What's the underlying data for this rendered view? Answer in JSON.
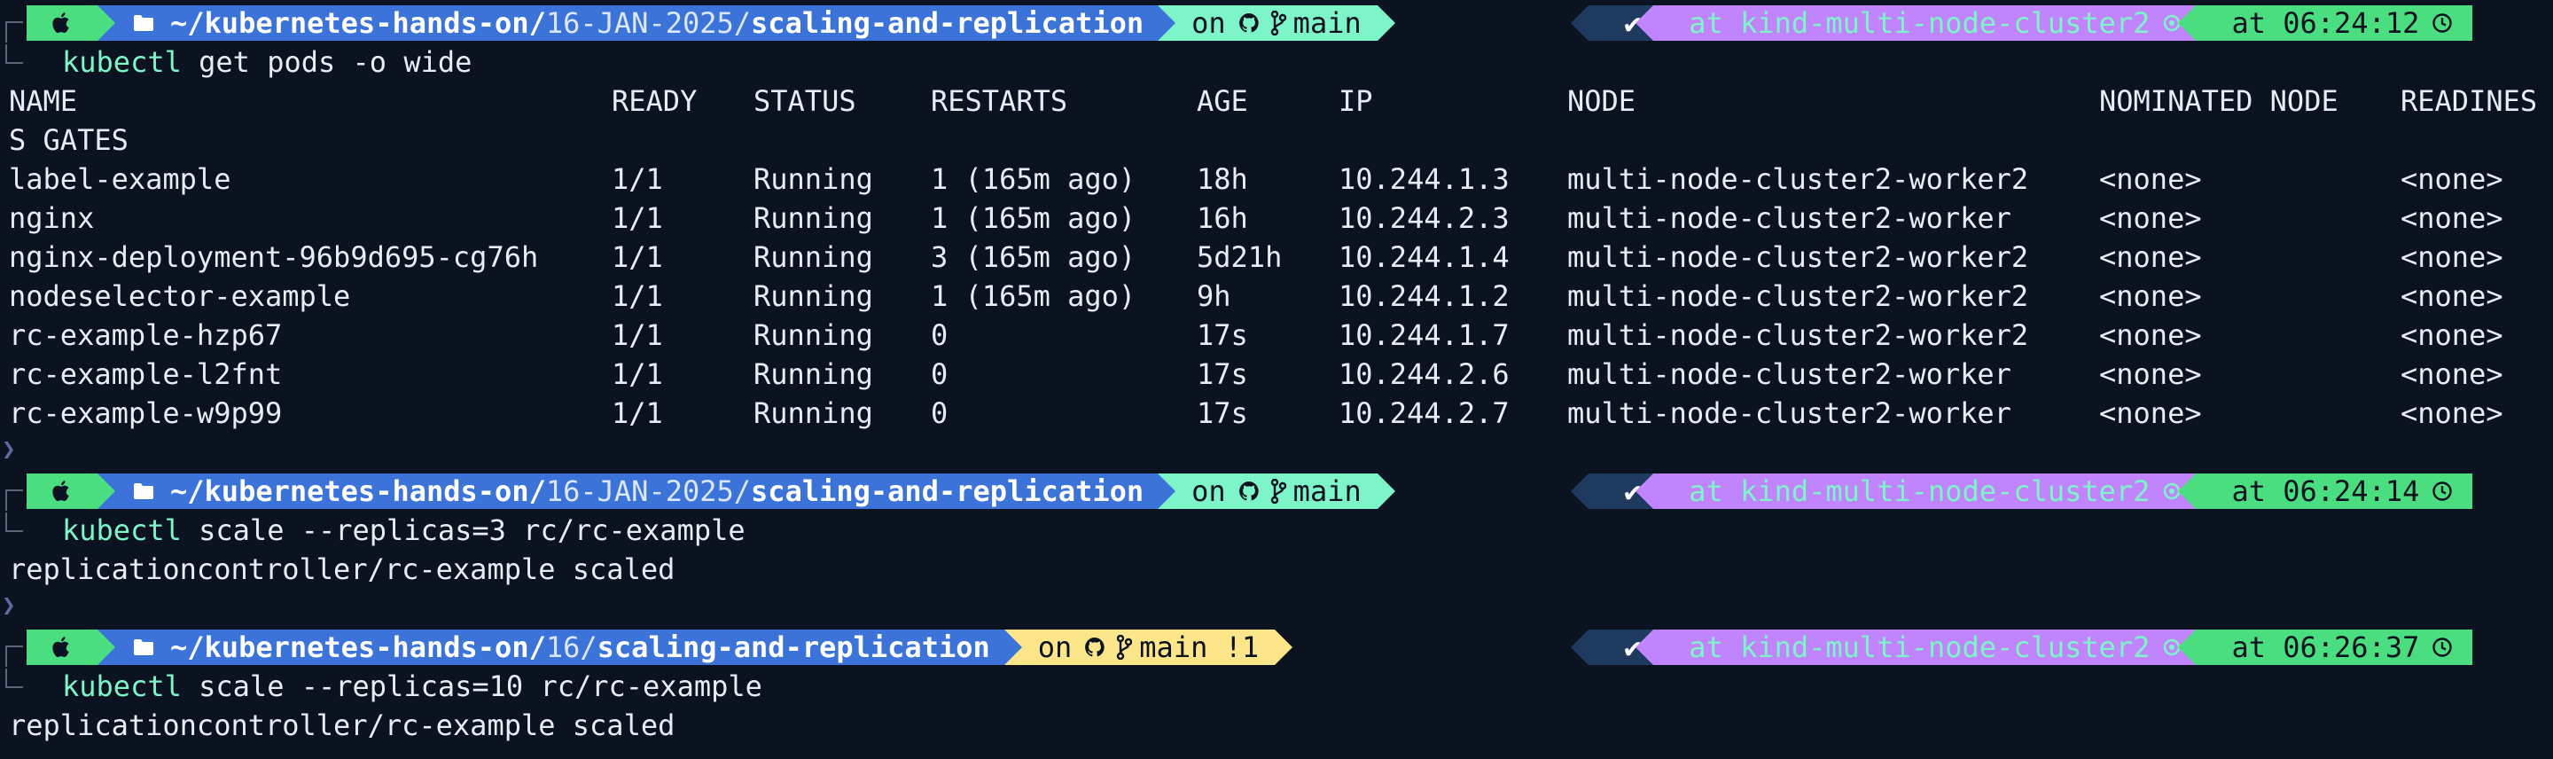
{
  "prompts": [
    {
      "path_prefix": "~/kubernetes-hands-on/",
      "path_mid": "16-JAN-2025",
      "path_sep": "/",
      "path_last": "scaling-and-replication",
      "git_on": "on",
      "git_branch": "main",
      "git_state": "clean",
      "status": "✔",
      "context": "at kind-multi-node-cluster2",
      "time": "at 06:24:12"
    },
    {
      "path_prefix": "~/kubernetes-hands-on/",
      "path_mid": "16-JAN-2025",
      "path_sep": "/",
      "path_last": "scaling-and-replication",
      "git_on": "on",
      "git_branch": "main",
      "git_state": "clean",
      "status": "✔",
      "context": "at kind-multi-node-cluster2",
      "time": "at 06:24:14"
    },
    {
      "path_prefix": "~/kubernetes-hands-on/",
      "path_mid": "16",
      "path_sep": "/",
      "path_last": "scaling-and-replication",
      "git_on": "on",
      "git_branch": "main !1",
      "git_state": "dirty",
      "status": "✔",
      "context": "at kind-multi-node-cluster2",
      "time": "at 06:26:37"
    }
  ],
  "commands": [
    {
      "bin": "kubectl",
      "args": " get pods -o wide"
    },
    {
      "bin": "kubectl",
      "args": " scale --replicas=3 rc/rc-example"
    },
    {
      "bin": "kubectl",
      "args": " scale --replicas=10 rc/rc-example"
    }
  ],
  "table": {
    "headers": [
      "NAME",
      "READY",
      "STATUS",
      "RESTARTS",
      "AGE",
      "IP",
      "NODE",
      "NOMINATED NODE",
      "READINES"
    ],
    "header_wrap": "S GATES",
    "rows": [
      [
        "label-example",
        "1/1",
        "Running",
        "1 (165m ago)",
        "18h",
        "10.244.1.3",
        "multi-node-cluster2-worker2",
        "<none>",
        "<none>"
      ],
      [
        "nginx",
        "1/1",
        "Running",
        "1 (165m ago)",
        "16h",
        "10.244.2.3",
        "multi-node-cluster2-worker",
        "<none>",
        "<none>"
      ],
      [
        "nginx-deployment-96b9d695-cg76h",
        "1/1",
        "Running",
        "3 (165m ago)",
        "5d21h",
        "10.244.1.4",
        "multi-node-cluster2-worker2",
        "<none>",
        "<none>"
      ],
      [
        "nodeselector-example",
        "1/1",
        "Running",
        "1 (165m ago)",
        "9h",
        "10.244.1.2",
        "multi-node-cluster2-worker2",
        "<none>",
        "<none>"
      ],
      [
        "rc-example-hzp67",
        "1/1",
        "Running",
        "0",
        "17s",
        "10.244.1.7",
        "multi-node-cluster2-worker2",
        "<none>",
        "<none>"
      ],
      [
        "rc-example-l2fnt",
        "1/1",
        "Running",
        "0",
        "17s",
        "10.244.2.6",
        "multi-node-cluster2-worker",
        "<none>",
        "<none>"
      ],
      [
        "rc-example-w9p99",
        "1/1",
        "Running",
        "0",
        "17s",
        "10.244.2.7",
        "multi-node-cluster2-worker",
        "<none>",
        "<none>"
      ]
    ]
  },
  "outputs": [
    "replicationcontroller/rc-example scaled",
    "replicationcontroller/rc-example scaled"
  ],
  "colors": {
    "background": "#0b1220",
    "os_segment": "#4ade80",
    "path_segment": "#3b73d9",
    "git_clean": "#7ef5c8",
    "git_dirty": "#fde68a",
    "status_segment": "#1e3a5f",
    "context_segment": "#c084fc",
    "time_segment": "#4ade80"
  },
  "icons": [
    "apple-icon",
    "folder-icon",
    "github-icon",
    "git-branch-icon",
    "checkmark-icon",
    "kubernetes-icon",
    "clock-icon"
  ]
}
